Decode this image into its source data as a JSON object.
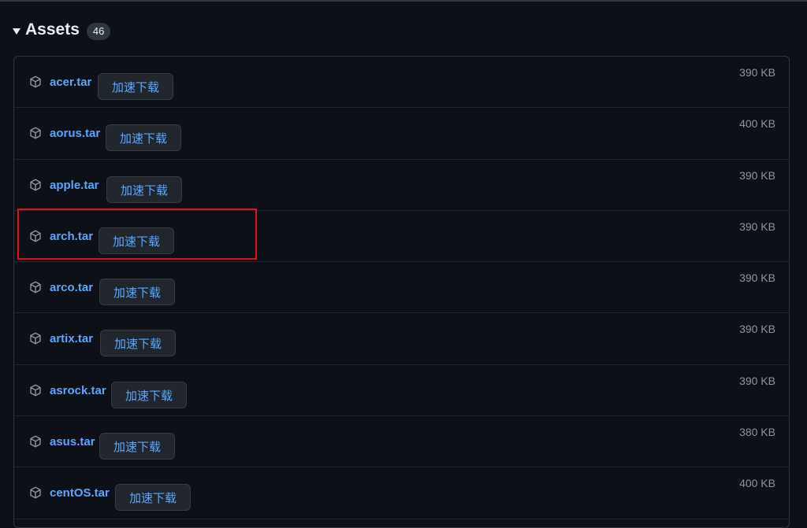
{
  "assets": {
    "title": "Assets",
    "count": "46",
    "items": [
      {
        "name": "acer.tar",
        "button": "加速下载",
        "size": "390 KB"
      },
      {
        "name": "aorus.tar",
        "button": "加速下载",
        "size": "400 KB"
      },
      {
        "name": "apple.tar",
        "button": "加速下载",
        "size": "390 KB"
      },
      {
        "name": "arch.tar",
        "button": "加速下载",
        "size": "390 KB"
      },
      {
        "name": "arco.tar",
        "button": "加速下载",
        "size": "390 KB"
      },
      {
        "name": "artix.tar",
        "button": "加速下载",
        "size": "390 KB"
      },
      {
        "name": "asrock.tar",
        "button": "加速下载",
        "size": "390 KB"
      },
      {
        "name": "asus.tar",
        "button": "加速下载",
        "size": "380 KB"
      },
      {
        "name": "centOS.tar",
        "button": "加速下载",
        "size": "400 KB"
      }
    ]
  },
  "colors": {
    "background": "#0d1117",
    "link": "#58a6ff",
    "highlight": "#e0101a"
  },
  "icons": {
    "asset": "package-icon",
    "toggle": "caret-down-icon"
  }
}
